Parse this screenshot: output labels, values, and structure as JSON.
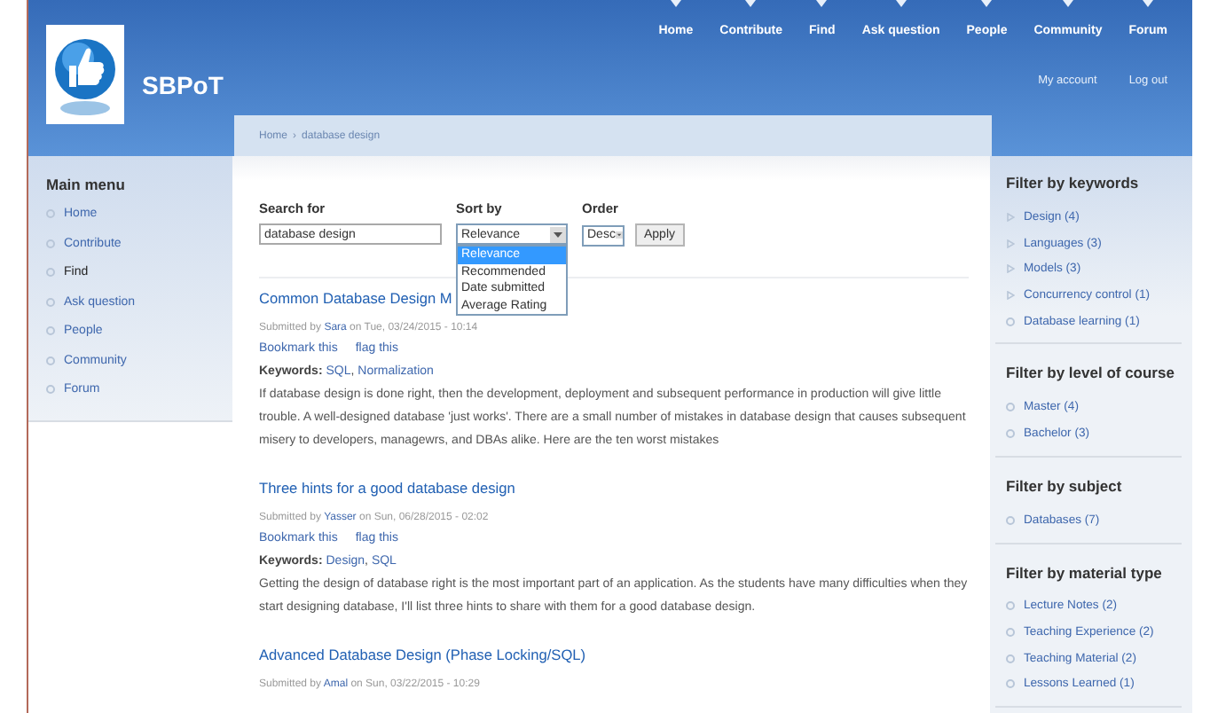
{
  "header": {
    "site_name": "SBPoT",
    "nav": [
      {
        "label": "Home"
      },
      {
        "label": "Contribute"
      },
      {
        "label": "Find"
      },
      {
        "label": "Ask question"
      },
      {
        "label": "People"
      },
      {
        "label": "Community"
      },
      {
        "label": "Forum"
      }
    ],
    "account_links": [
      "My account",
      "Log out"
    ]
  },
  "breadcrumb": {
    "items": [
      "Home",
      "database design"
    ],
    "separator": "›"
  },
  "main_menu": {
    "title": "Main menu",
    "items": [
      {
        "label": "Home",
        "selected": false
      },
      {
        "label": "Contribute",
        "selected": false
      },
      {
        "label": "Find",
        "selected": true
      },
      {
        "label": "Ask question",
        "selected": false
      },
      {
        "label": "People",
        "selected": false
      },
      {
        "label": "Community",
        "selected": false
      },
      {
        "label": "Forum",
        "selected": false
      }
    ]
  },
  "search": {
    "search_label": "Search for",
    "search_value": "database design",
    "sort_label": "Sort by",
    "sort_value": "Relevance",
    "sort_expanded": true,
    "sort_options": [
      {
        "label": "Relevance",
        "selected": true
      },
      {
        "label": "Recommended",
        "selected": false
      },
      {
        "label": "Date submitted",
        "selected": false
      },
      {
        "label": "Average Rating",
        "selected": false
      }
    ],
    "order_label": "Order",
    "order_value": "Desc",
    "apply": "Apply"
  },
  "results": [
    {
      "title": "Common Database Design M",
      "submitted_prefix": "Submitted by",
      "author": "Sara",
      "date": "on Tue, 03/24/2015 - 10:14",
      "actions": [
        "Bookmark this",
        "flag this"
      ],
      "keywords_label": "Keywords:",
      "keywords_separator": ",",
      "keywords": [
        "SQL",
        "Normalization"
      ],
      "summary": "If database design is done right, then the development, deployment and subsequent performance in production will give little trouble. A well-designed database 'just works'. There are a small number of mistakes in database design that causes subsequent misery to developers, managewrs, and DBAs alike. Here are the ten worst mistakes"
    },
    {
      "title": "Three hints for a good database design",
      "submitted_prefix": "Submitted by",
      "author": "Yasser",
      "date": "on Sun, 06/28/2015 - 02:02",
      "actions": [
        "Bookmark this",
        "flag this"
      ],
      "keywords_label": "Keywords:",
      "keywords_separator": ",",
      "keywords": [
        "Design",
        "SQL"
      ],
      "summary": "Getting the design of database right is the most important part of an application. As the students have many difficulties when they start designing database, I'll list three hints to share with them for a good database design."
    },
    {
      "title": "Advanced Database Design (Phase Locking/SQL)",
      "submitted_prefix": "Submitted by",
      "author": "Amal",
      "date": "on Sun, 03/22/2015 - 10:29"
    }
  ],
  "filters": [
    {
      "title": "Filter by keywords",
      "items": [
        {
          "label": "Design (4)",
          "expandable": true
        },
        {
          "label": "Languages (3)",
          "expandable": true
        },
        {
          "label": "Models (3)",
          "expandable": true
        },
        {
          "label": "Concurrency control (1)",
          "expandable": true
        },
        {
          "label": "Database learning (1)",
          "expandable": false
        }
      ]
    },
    {
      "title": "Filter by level of course",
      "items": [
        {
          "label": "Master (4)",
          "expandable": false
        },
        {
          "label": "Bachelor (3)",
          "expandable": false
        }
      ]
    },
    {
      "title": "Filter by subject",
      "items": [
        {
          "label": "Databases (7)",
          "expandable": false
        }
      ]
    },
    {
      "title": "Filter by material type",
      "items": [
        {
          "label": "Lecture Notes (2)",
          "expandable": false
        },
        {
          "label": "Teaching Experience (2)",
          "expandable": false
        },
        {
          "label": "Teaching Material (2)",
          "expandable": false
        },
        {
          "label": "Lessons Learned (1)",
          "expandable": false
        }
      ]
    }
  ]
}
